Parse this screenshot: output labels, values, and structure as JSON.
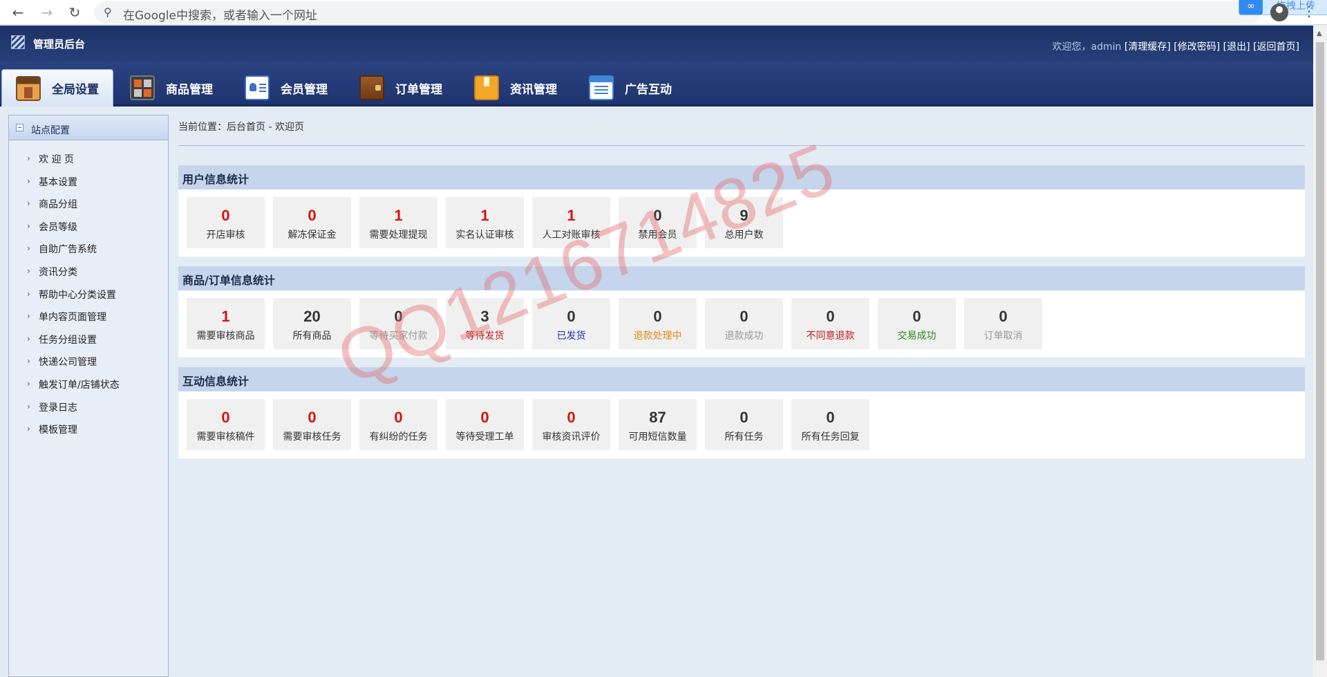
{
  "browser": {
    "omnibox_placeholder": "在Google中搜索，或者输入一个网址",
    "extension_label": "拖拽上传"
  },
  "header": {
    "title": "管理员后台",
    "welcome": "欢迎您，admin",
    "links": [
      "[清理缓存]",
      "[修改密码]",
      "[退出]",
      "[返回首页]"
    ]
  },
  "nav": {
    "tabs": [
      {
        "label": "全局设置",
        "icon": "settings-icon",
        "active": true
      },
      {
        "label": "商品管理",
        "icon": "goods-icon",
        "active": false
      },
      {
        "label": "会员管理",
        "icon": "member-icon",
        "active": false
      },
      {
        "label": "订单管理",
        "icon": "order-icon",
        "active": false
      },
      {
        "label": "资讯管理",
        "icon": "news-icon",
        "active": false
      },
      {
        "label": "广告互动",
        "icon": "ad-icon",
        "active": false
      }
    ]
  },
  "sidebar": {
    "section": "站点配置",
    "items": [
      "欢 迎 页",
      "基本设置",
      "商品分组",
      "会员等级",
      "自助广告系统",
      "资讯分类",
      "帮助中心分类设置",
      "单内容页面管理",
      "任务分组设置",
      "快递公司管理",
      "触发订单/店铺状态",
      "登录日志",
      "模板管理"
    ]
  },
  "breadcrumb": "当前位置：后台首页 - 欢迎页",
  "panels": [
    {
      "title": "用户信息统计",
      "stats": [
        {
          "value": "0",
          "label": "开店审核"
        },
        {
          "value": "0",
          "label": "解冻保证金"
        },
        {
          "value": "1",
          "label": "需要处理提现"
        },
        {
          "value": "1",
          "label": "实名认证审核"
        },
        {
          "value": "1",
          "label": "人工对账审核"
        },
        {
          "value": "0",
          "label": "禁用会员"
        },
        {
          "value": "9",
          "label": "总用户数"
        }
      ]
    },
    {
      "title": "商品/订单信息统计",
      "stats": [
        {
          "value": "1",
          "label": "需要审核商品"
        },
        {
          "value": "20",
          "label": "所有商品"
        },
        {
          "value": "0",
          "label": "等待买家付款"
        },
        {
          "value": "3",
          "label": "等待发货"
        },
        {
          "value": "0",
          "label": "已发货"
        },
        {
          "value": "0",
          "label": "退款处理中"
        },
        {
          "value": "0",
          "label": "退款成功"
        },
        {
          "value": "0",
          "label": "不同意退款"
        },
        {
          "value": "0",
          "label": "交易成功"
        },
        {
          "value": "0",
          "label": "订单取消"
        }
      ]
    },
    {
      "title": "互动信息统计",
      "stats": [
        {
          "value": "0",
          "label": "需要审核稿件"
        },
        {
          "value": "0",
          "label": "需要审核任务"
        },
        {
          "value": "0",
          "label": "有纠纷的任务"
        },
        {
          "value": "0",
          "label": "等待受理工单"
        },
        {
          "value": "0",
          "label": "审核资讯评价"
        },
        {
          "value": "87",
          "label": "可用短信数量"
        },
        {
          "value": "0",
          "label": "所有任务"
        },
        {
          "value": "0",
          "label": "所有任务回复"
        }
      ]
    }
  ],
  "watermark": "QQ1216714825",
  "colors": {
    "alert_red": "#d81111",
    "nav_blue": "#1d3264",
    "panel_head": "#c4d5ec"
  }
}
